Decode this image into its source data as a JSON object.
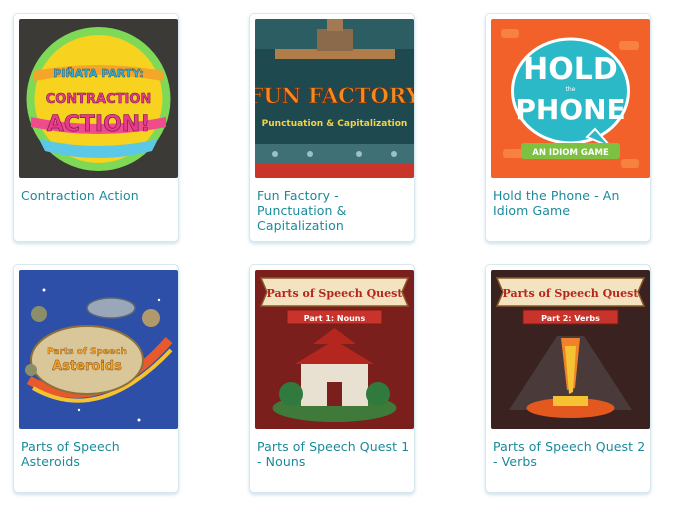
{
  "games": [
    {
      "title": "Contraction Action",
      "art_lines": [
        "PIÑATA PARTY:",
        "CONTRACTION",
        "ACTION!"
      ],
      "art_icon": "pinata-art"
    },
    {
      "title": "Fun Factory - Punctuation & Capitalization",
      "art_lines": [
        "FUN FACTORY",
        "Punctuation & Capitalization"
      ],
      "art_icon": "factory-art"
    },
    {
      "title": "Hold the Phone - An Idiom Game",
      "art_lines": [
        "HOLD",
        "the",
        "PHONE",
        "AN IDIOM GAME"
      ],
      "art_icon": "phone-art"
    },
    {
      "title": "Parts of Speech Asteroids",
      "art_lines": [
        "Parts of Speech",
        "Asteroids"
      ],
      "art_icon": "asteroids-art"
    },
    {
      "title": "Parts of Speech Quest 1 - Nouns",
      "art_lines": [
        "Parts of Speech Quest",
        "Part 1: Nouns"
      ],
      "art_icon": "castle-art"
    },
    {
      "title": "Parts of Speech Quest 2 - Verbs",
      "art_lines": [
        "Parts of Speech Quest",
        "Part 2: Verbs"
      ],
      "art_icon": "volcano-art"
    }
  ],
  "colors": {
    "link": "#1a8a9a",
    "card_border": "#d8e8ef"
  }
}
